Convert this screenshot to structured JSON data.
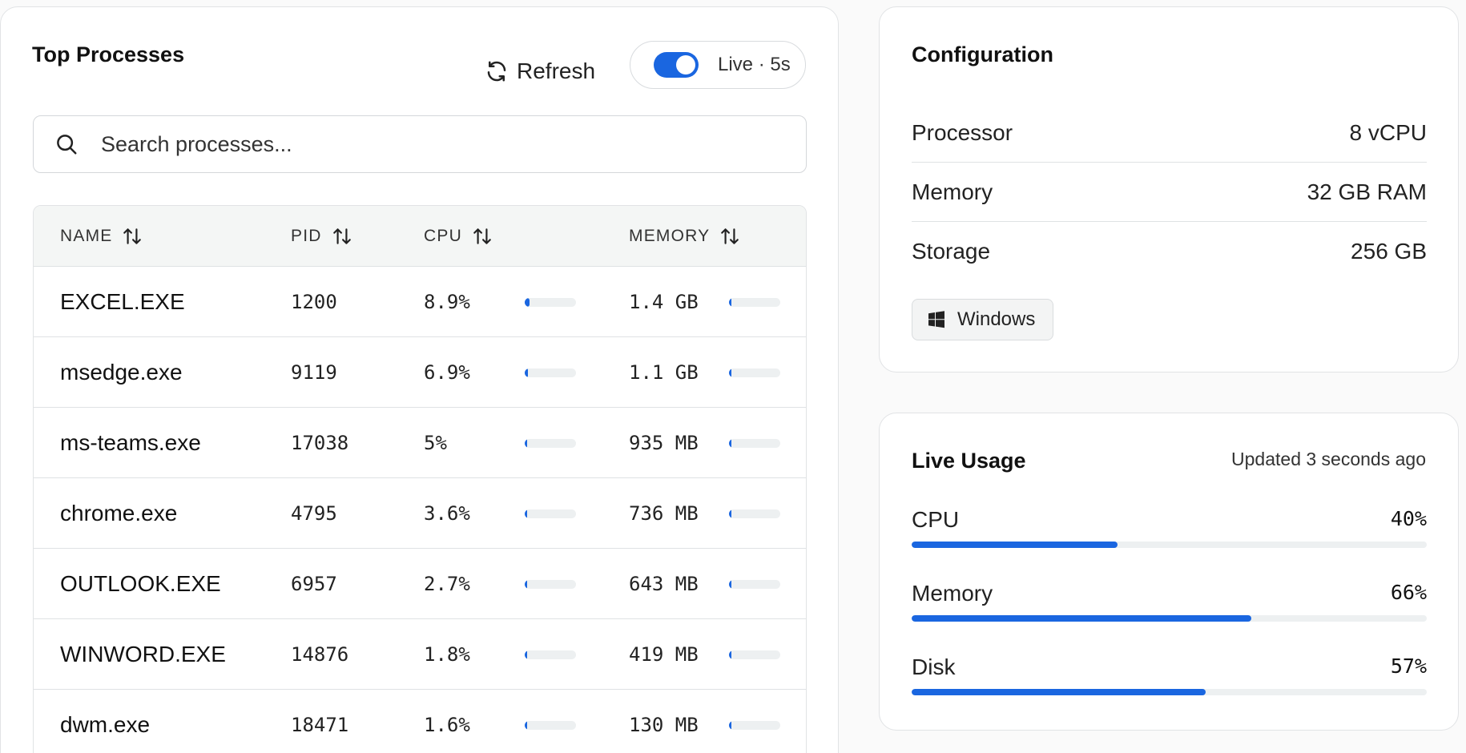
{
  "processes": {
    "title": "Top Processes",
    "refresh_label": "Refresh",
    "live_label": "Live · 5s",
    "live_enabled": true,
    "search_placeholder": "Search processes...",
    "columns": [
      "NAME",
      "PID",
      "CPU",
      "MEMORY"
    ],
    "rows": [
      {
        "name": "EXCEL.EXE",
        "pid": "1200",
        "cpu": "8.9%",
        "cpu_fraction": 0.089,
        "memory": "1.4 GB",
        "mem_fraction": 0.044
      },
      {
        "name": "msedge.exe",
        "pid": "9119",
        "cpu": "6.9%",
        "cpu_fraction": 0.069,
        "memory": "1.1 GB",
        "mem_fraction": 0.034
      },
      {
        "name": "ms-teams.exe",
        "pid": "17038",
        "cpu": "5%",
        "cpu_fraction": 0.05,
        "memory": "935 MB",
        "mem_fraction": 0.029
      },
      {
        "name": "chrome.exe",
        "pid": "4795",
        "cpu": "3.6%",
        "cpu_fraction": 0.036,
        "memory": "736 MB",
        "mem_fraction": 0.023
      },
      {
        "name": "OUTLOOK.EXE",
        "pid": "6957",
        "cpu": "2.7%",
        "cpu_fraction": 0.027,
        "memory": "643 MB",
        "mem_fraction": 0.02
      },
      {
        "name": "WINWORD.EXE",
        "pid": "14876",
        "cpu": "1.8%",
        "cpu_fraction": 0.018,
        "memory": "419 MB",
        "mem_fraction": 0.013
      },
      {
        "name": "dwm.exe",
        "pid": "18471",
        "cpu": "1.6%",
        "cpu_fraction": 0.016,
        "memory": "130 MB",
        "mem_fraction": 0.004
      }
    ]
  },
  "configuration": {
    "title": "Configuration",
    "items": [
      {
        "label": "Processor",
        "value": "8 vCPU"
      },
      {
        "label": "Memory",
        "value": "32 GB RAM"
      },
      {
        "label": "Storage",
        "value": "256 GB"
      }
    ],
    "os_label": "Windows",
    "os_icon": "windows-icon"
  },
  "live_usage": {
    "title": "Live Usage",
    "updated": "Updated 3 seconds ago",
    "metrics": [
      {
        "label": "CPU",
        "value": "40%",
        "fraction": 0.4
      },
      {
        "label": "Memory",
        "value": "66%",
        "fraction": 0.66
      },
      {
        "label": "Disk",
        "value": "57%",
        "fraction": 0.57
      }
    ]
  },
  "colors": {
    "accent": "#1a66e0",
    "track": "#edf0f1",
    "border": "#e1e3e5"
  }
}
